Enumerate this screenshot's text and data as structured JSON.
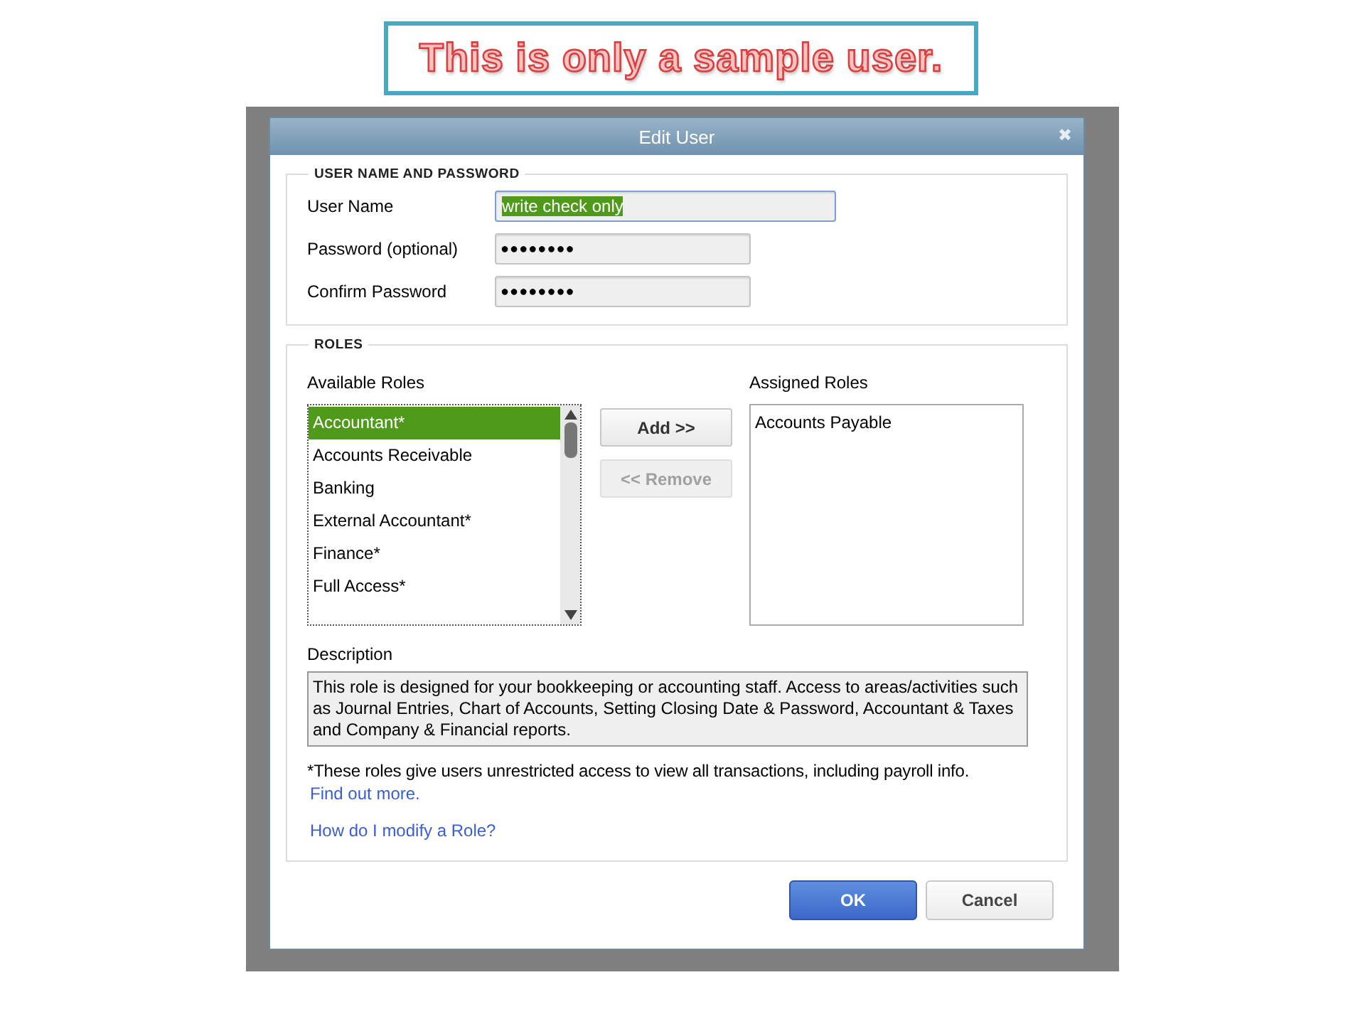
{
  "banner": {
    "text": "This is only a sample user."
  },
  "window": {
    "title": "Edit User",
    "close": "✖"
  },
  "user_section": {
    "heading": "USER NAME AND PASSWORD",
    "fields": [
      {
        "label": "User Name",
        "value": "write check only",
        "kind": "text",
        "selected": true
      },
      {
        "label": "Password (optional)",
        "value": "●●●●●●●●",
        "kind": "password",
        "selected": false
      },
      {
        "label": "Confirm Password",
        "value": "●●●●●●●●",
        "kind": "password",
        "selected": false
      }
    ]
  },
  "roles": {
    "heading": "ROLES",
    "available": {
      "label": "Available Roles",
      "items": [
        {
          "label": "Accountant*",
          "selected": true
        },
        {
          "label": "Accounts Receivable",
          "selected": false
        },
        {
          "label": "Banking",
          "selected": false
        },
        {
          "label": "External Accountant*",
          "selected": false
        },
        {
          "label": "Finance*",
          "selected": false
        },
        {
          "label": "Full Access*",
          "selected": false
        }
      ]
    },
    "buttons": [
      {
        "label": "Add >>",
        "disabled": false
      },
      {
        "label": "<< Remove",
        "disabled": true
      }
    ],
    "assigned": {
      "label": "Assigned Roles",
      "items": [
        {
          "label": "Accounts Payable",
          "selected": false
        }
      ]
    },
    "description": {
      "label": "Description",
      "text": "This role is designed for your bookkeeping or accounting staff. Access to areas/activities such as Journal Entries, Chart of Accounts, Setting Closing Date & Password, Accountant & Taxes and Company & Financial reports."
    },
    "note": "*These roles give users unrestricted access to view all transactions, including payroll info.",
    "links": [
      "Find out more.",
      "How do I modify a Role?"
    ]
  },
  "footer_buttons": [
    {
      "label": "OK",
      "kind": "primary"
    },
    {
      "label": "Cancel",
      "kind": "secondary"
    }
  ]
}
